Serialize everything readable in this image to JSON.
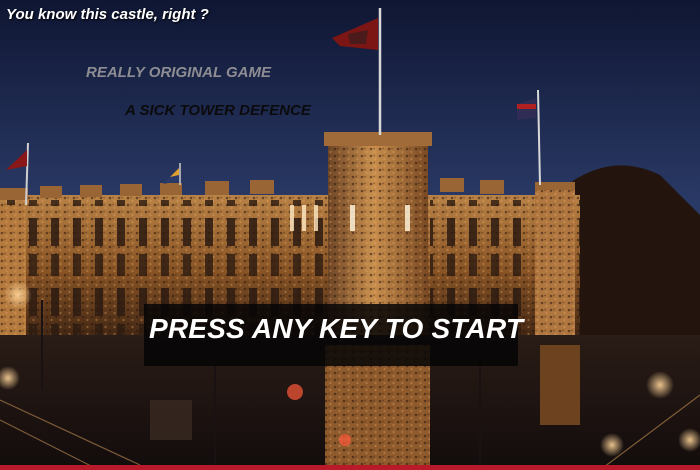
{
  "screen": {
    "intro_text": "You know this castle, right ?",
    "tagline_primary": "REALLY ORIGINAL GAME",
    "tagline_secondary": "A SICK TOWER DEFENCE",
    "start_prompt": "PRESS ANY KEY TO START"
  },
  "colors": {
    "sky_top": "#101735",
    "sky_bottom": "#6a7fa6",
    "stone_lit": "#c9893e",
    "banner": "#070607",
    "accent_bar": "#b81a2a"
  },
  "icons": [
    "flag-icon"
  ]
}
